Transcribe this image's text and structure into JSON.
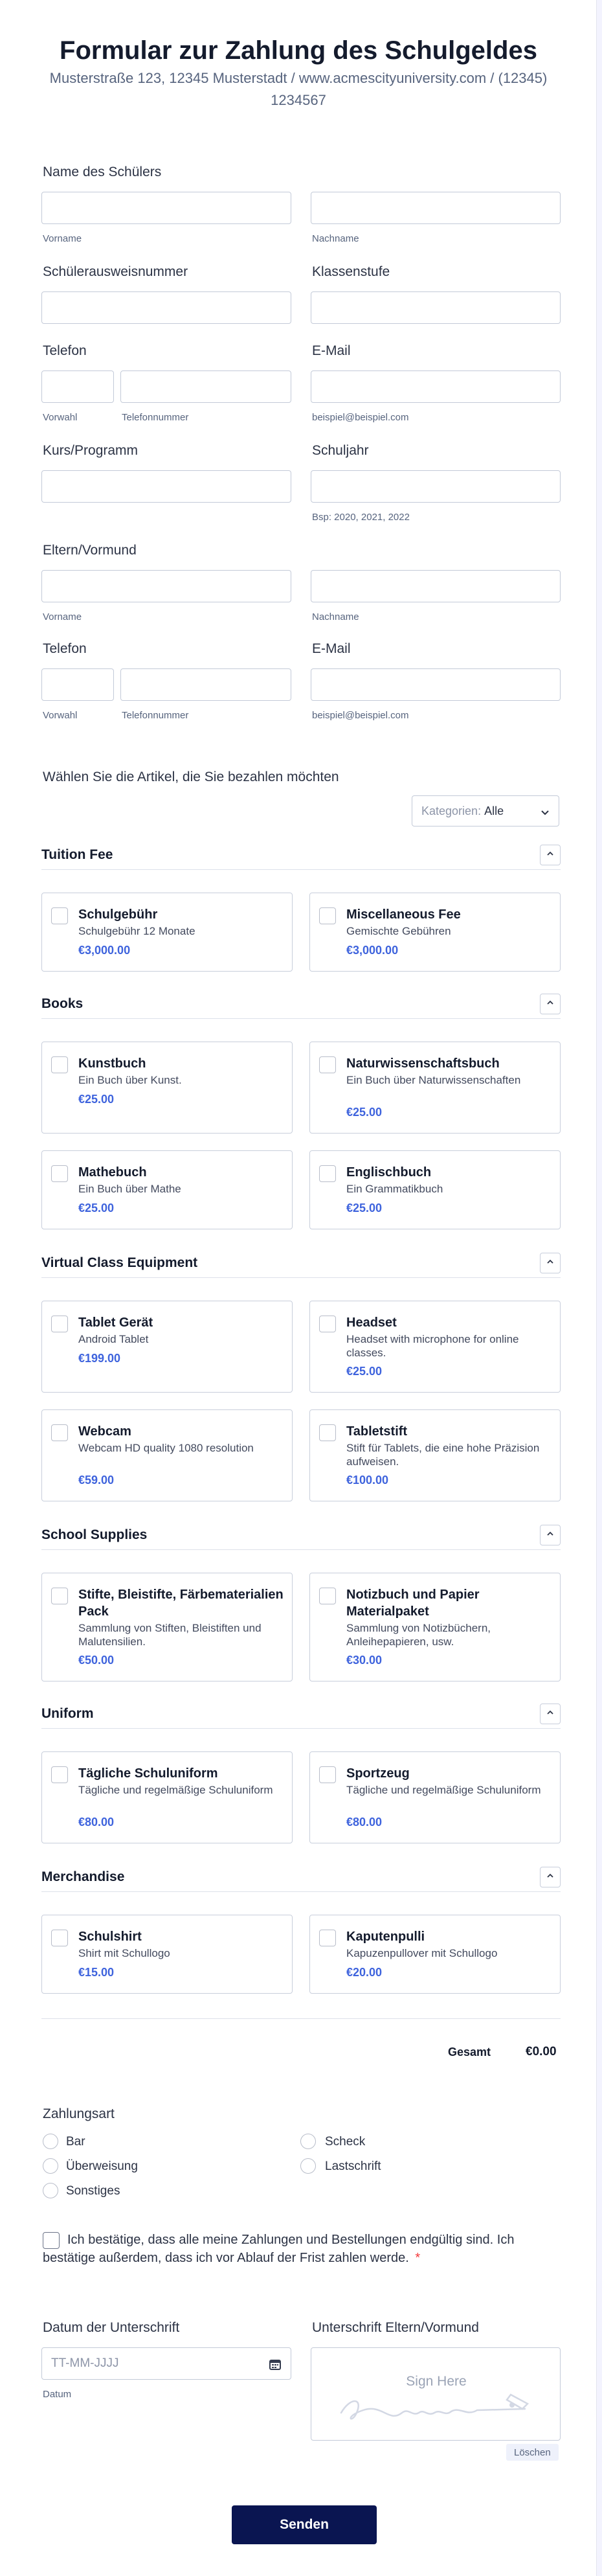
{
  "header": {
    "title": "Formular zur Zahlung des Schulgeldes",
    "subtitle": "Musterstraße 123, 12345 Musterstadt / www.acmescityuniversity.com / (12345) 1234567"
  },
  "fields": {
    "student_name": {
      "label": "Name des Schülers",
      "first_sub": "Vorname",
      "last_sub": "Nachname"
    },
    "student_id": {
      "label": "Schülerausweisnummer"
    },
    "grade": {
      "label": "Klassenstufe"
    },
    "phone1": {
      "label": "Telefon",
      "area_sub": "Vorwahl",
      "number_sub": "Telefonnummer"
    },
    "email1": {
      "label": "E-Mail",
      "sub": "beispiel@beispiel.com"
    },
    "course": {
      "label": "Kurs/Programm"
    },
    "school_year": {
      "label": "Schuljahr",
      "sub": "Bsp: 2020, 2021, 2022"
    },
    "guardian": {
      "label": "Eltern/Vormund",
      "first_sub": "Vorname",
      "last_sub": "Nachname"
    },
    "phone2": {
      "label": "Telefon",
      "area_sub": "Vorwahl",
      "number_sub": "Telefonnummer"
    },
    "email2": {
      "label": "E-Mail",
      "sub": "beispiel@beispiel.com"
    }
  },
  "products": {
    "label": "Wählen Sie die Artikel, die Sie bezahlen möchten",
    "filter_prefix": "Kategorien:",
    "filter_value": "Alle",
    "sections": [
      {
        "title": "Tuition Fee",
        "items": [
          {
            "name": "Schulgebühr",
            "desc": "Schulgebühr 12 Monate",
            "price": "€3,000.00"
          },
          {
            "name": "Miscellaneous Fee",
            "desc": "Gemischte Gebühren",
            "price": "€3,000.00"
          }
        ]
      },
      {
        "title": "Books",
        "items": [
          {
            "name": "Kunstbuch",
            "desc": "Ein Buch über Kunst.",
            "price": "€25.00"
          },
          {
            "name": "Naturwissenschaftsbuch",
            "desc": "Ein Buch über Naturwissenschaften",
            "price": "€25.00"
          },
          {
            "name": "Mathebuch",
            "desc": "Ein Buch über Mathe",
            "price": "€25.00"
          },
          {
            "name": "Englischbuch",
            "desc": "Ein Grammatikbuch",
            "price": "€25.00"
          }
        ]
      },
      {
        "title": "Virtual Class Equipment",
        "items": [
          {
            "name": "Tablet Gerät",
            "desc": "Android Tablet",
            "price": "€199.00"
          },
          {
            "name": "Headset",
            "desc": "Headset with microphone for online classes.",
            "price": "€25.00"
          },
          {
            "name": "Webcam",
            "desc": "Webcam HD quality 1080 resolution",
            "price": "€59.00"
          },
          {
            "name": "Tabletstift",
            "desc": "Stift für Tablets, die eine hohe Präzision aufweisen.",
            "price": "€100.00"
          }
        ]
      },
      {
        "title": "School Supplies",
        "items": [
          {
            "name": "Stifte, Bleistifte, Färbematerialien Pack",
            "desc": "Sammlung von Stiften, Bleistiften und Malutensilien.",
            "price": "€50.00"
          },
          {
            "name": "Notizbuch und Papier Materialpaket",
            "desc": "Sammlung von Notizbüchern, Anleihepapieren, usw.",
            "price": "€30.00"
          }
        ]
      },
      {
        "title": "Uniform",
        "items": [
          {
            "name": "Tägliche Schuluniform",
            "desc": "Tägliche und regelmäßige Schuluniform",
            "price": "€80.00"
          },
          {
            "name": "Sportzeug",
            "desc": "Tägliche und regelmäßige Schuluniform",
            "price": "€80.00"
          }
        ]
      },
      {
        "title": "Merchandise",
        "items": [
          {
            "name": "Schulshirt",
            "desc": "Shirt mit Schullogo",
            "price": "€15.00"
          },
          {
            "name": "Kaputenpulli",
            "desc": "Kapuzenpullover mit Schullogo",
            "price": "€20.00"
          }
        ]
      }
    ],
    "total_label": "Gesamt",
    "total_value": "€0.00"
  },
  "payment": {
    "label": "Zahlungsart",
    "options": [
      "Bar",
      "Scheck",
      "Überweisung",
      "Lastschrift",
      "Sonstiges"
    ]
  },
  "confirm": {
    "text": "Ich bestätige, dass alle meine Zahlungen und Bestellungen endgültig sind. Ich bestätige außerdem, dass ich vor Ablauf der Frist zahlen werde.",
    "required_mark": "*"
  },
  "signature": {
    "date_label": "Datum der Unterschrift",
    "date_placeholder": "TT-MM-JJJJ",
    "date_sub": "Datum",
    "sign_label": "Unterschrift Eltern/Vormund",
    "sign_placeholder": "Sign Here",
    "clear_label": "Löschen"
  },
  "submit_label": "Senden",
  "colors": {
    "accent": "#3e63dd",
    "button": "#0a1551",
    "background": "#f3f3fe",
    "required": "#f23a3c"
  }
}
